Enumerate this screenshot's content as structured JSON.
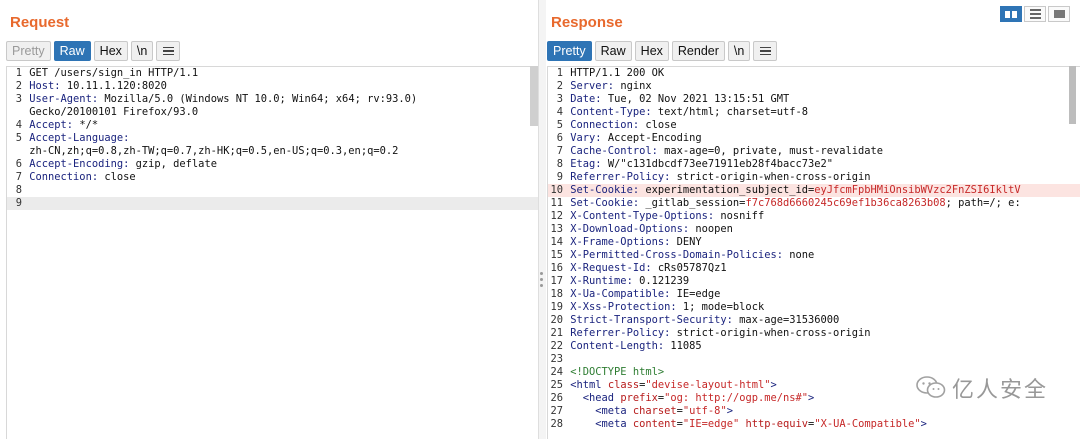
{
  "request": {
    "title": "Request",
    "tabs": [
      "Pretty",
      "Raw",
      "Hex",
      "\\n"
    ],
    "lines": [
      {
        "num": "1",
        "parts": [
          {
            "c": "code",
            "t": "GET /users/sign_in HTTP/1.1"
          }
        ]
      },
      {
        "num": "2",
        "parts": [
          {
            "c": "hk",
            "t": "Host: "
          },
          {
            "c": "hv",
            "t": "10.11.1.120:8020"
          }
        ]
      },
      {
        "num": "3",
        "parts": [
          {
            "c": "hk",
            "t": "User-Agent: "
          },
          {
            "c": "hv",
            "t": "Mozilla/5.0 (Windows NT 10.0; Win64; x64; rv:93.0)"
          }
        ]
      },
      {
        "num": "",
        "cont": true,
        "parts": [
          {
            "c": "hv",
            "t": "Gecko/20100101 Firefox/93.0"
          }
        ]
      },
      {
        "num": "4",
        "parts": [
          {
            "c": "hk",
            "t": "Accept: "
          },
          {
            "c": "hv",
            "t": "*/*"
          }
        ]
      },
      {
        "num": "5",
        "parts": [
          {
            "c": "hk",
            "t": "Accept-Language: "
          }
        ]
      },
      {
        "num": "",
        "cont": true,
        "parts": [
          {
            "c": "hv",
            "t": "zh-CN,zh;q=0.8,zh-TW;q=0.7,zh-HK;q=0.5,en-US;q=0.3,en;q=0.2"
          }
        ]
      },
      {
        "num": "6",
        "parts": [
          {
            "c": "hk",
            "t": "Accept-Encoding: "
          },
          {
            "c": "hv",
            "t": "gzip, deflate"
          }
        ]
      },
      {
        "num": "7",
        "parts": [
          {
            "c": "hk",
            "t": "Connection: "
          },
          {
            "c": "hv",
            "t": "close"
          }
        ]
      },
      {
        "num": "8",
        "parts": [
          {
            "c": "code",
            "t": ""
          }
        ]
      },
      {
        "num": "9",
        "active": true,
        "parts": [
          {
            "c": "code",
            "t": ""
          }
        ]
      }
    ]
  },
  "response": {
    "title": "Response",
    "tabs": [
      "Pretty",
      "Raw",
      "Hex",
      "Render",
      "\\n"
    ],
    "lines": [
      {
        "num": "1",
        "parts": [
          {
            "c": "code",
            "t": "HTTP/1.1 200 OK"
          }
        ]
      },
      {
        "num": "2",
        "parts": [
          {
            "c": "hk",
            "t": "Server: "
          },
          {
            "c": "hv",
            "t": "nginx"
          }
        ]
      },
      {
        "num": "3",
        "parts": [
          {
            "c": "hk",
            "t": "Date: "
          },
          {
            "c": "hv",
            "t": "Tue, 02 Nov 2021 13:15:51 GMT"
          }
        ]
      },
      {
        "num": "4",
        "parts": [
          {
            "c": "hk",
            "t": "Content-Type: "
          },
          {
            "c": "hv",
            "t": "text/html; charset=utf-8"
          }
        ]
      },
      {
        "num": "5",
        "parts": [
          {
            "c": "hk",
            "t": "Connection: "
          },
          {
            "c": "hv",
            "t": "close"
          }
        ]
      },
      {
        "num": "6",
        "parts": [
          {
            "c": "hk",
            "t": "Vary: "
          },
          {
            "c": "hv",
            "t": "Accept-Encoding"
          }
        ]
      },
      {
        "num": "7",
        "parts": [
          {
            "c": "hk",
            "t": "Cache-Control: "
          },
          {
            "c": "hv",
            "t": "max-age=0, private, must-revalidate"
          }
        ]
      },
      {
        "num": "8",
        "parts": [
          {
            "c": "hk",
            "t": "Etag: "
          },
          {
            "c": "hv",
            "t": "W/\"c131dbcdf73ee71911eb28f4bacc73e2\""
          }
        ]
      },
      {
        "num": "9",
        "parts": [
          {
            "c": "hk",
            "t": "Referrer-Policy: "
          },
          {
            "c": "hv",
            "t": "strict-origin-when-cross-origin"
          }
        ]
      },
      {
        "num": "10",
        "hl": true,
        "parts": [
          {
            "c": "hk",
            "t": "Set-Cookie: "
          },
          {
            "c": "ck",
            "t": "experimentation_subject_id="
          },
          {
            "c": "cv",
            "t": "eyJfcmFpbHMiOnsibWVzc2FnZSI6IkltV"
          }
        ]
      },
      {
        "num": "11",
        "parts": [
          {
            "c": "hk",
            "t": "Set-Cookie: "
          },
          {
            "c": "ck",
            "t": "_gitlab_session="
          },
          {
            "c": "cv",
            "t": "f7c768d6660245c69ef1b36ca8263b08"
          },
          {
            "c": "hv",
            "t": "; path=/; e:"
          }
        ]
      },
      {
        "num": "12",
        "parts": [
          {
            "c": "hk",
            "t": "X-Content-Type-Options: "
          },
          {
            "c": "hv",
            "t": "nosniff"
          }
        ]
      },
      {
        "num": "13",
        "parts": [
          {
            "c": "hk",
            "t": "X-Download-Options: "
          },
          {
            "c": "hv",
            "t": "noopen"
          }
        ]
      },
      {
        "num": "14",
        "parts": [
          {
            "c": "hk",
            "t": "X-Frame-Options: "
          },
          {
            "c": "hv",
            "t": "DENY"
          }
        ]
      },
      {
        "num": "15",
        "parts": [
          {
            "c": "hk",
            "t": "X-Permitted-Cross-Domain-Policies: "
          },
          {
            "c": "hv",
            "t": "none"
          }
        ]
      },
      {
        "num": "16",
        "parts": [
          {
            "c": "hk",
            "t": "X-Request-Id: "
          },
          {
            "c": "hv",
            "t": "cRs05787Qz1"
          }
        ]
      },
      {
        "num": "17",
        "parts": [
          {
            "c": "hk",
            "t": "X-Runtime: "
          },
          {
            "c": "hv",
            "t": "0.121239"
          }
        ]
      },
      {
        "num": "18",
        "parts": [
          {
            "c": "hk",
            "t": "X-Ua-Compatible: "
          },
          {
            "c": "hv",
            "t": "IE=edge"
          }
        ]
      },
      {
        "num": "19",
        "parts": [
          {
            "c": "hk",
            "t": "X-Xss-Protection: "
          },
          {
            "c": "hv",
            "t": "1; mode=block"
          }
        ]
      },
      {
        "num": "20",
        "parts": [
          {
            "c": "hk",
            "t": "Strict-Transport-Security: "
          },
          {
            "c": "hv",
            "t": "max-age=31536000"
          }
        ]
      },
      {
        "num": "21",
        "parts": [
          {
            "c": "hk",
            "t": "Referrer-Policy: "
          },
          {
            "c": "hv",
            "t": "strict-origin-when-cross-origin"
          }
        ]
      },
      {
        "num": "22",
        "parts": [
          {
            "c": "hk",
            "t": "Content-Length: "
          },
          {
            "c": "hv",
            "t": "11085"
          }
        ]
      },
      {
        "num": "23",
        "parts": [
          {
            "c": "code",
            "t": ""
          }
        ]
      },
      {
        "num": "24",
        "parts": [
          {
            "c": "comment",
            "t": "<!DOCTYPE html>"
          }
        ]
      },
      {
        "num": "25",
        "parts": [
          {
            "c": "tag",
            "t": "<html "
          },
          {
            "c": "attr",
            "t": "class"
          },
          {
            "c": "punct",
            "t": "="
          },
          {
            "c": "val",
            "t": "\"devise-layout-html\""
          },
          {
            "c": "tag",
            "t": ">"
          }
        ]
      },
      {
        "num": "26",
        "parts": [
          {
            "c": "code",
            "t": "  "
          },
          {
            "c": "tag",
            "t": "<head "
          },
          {
            "c": "attr",
            "t": "prefix"
          },
          {
            "c": "punct",
            "t": "="
          },
          {
            "c": "val",
            "t": "\"og: http://ogp.me/ns#\""
          },
          {
            "c": "tag",
            "t": ">"
          }
        ]
      },
      {
        "num": "27",
        "parts": [
          {
            "c": "code",
            "t": "    "
          },
          {
            "c": "tag",
            "t": "<meta "
          },
          {
            "c": "attr",
            "t": "charset"
          },
          {
            "c": "punct",
            "t": "="
          },
          {
            "c": "val",
            "t": "\"utf-8\""
          },
          {
            "c": "tag",
            "t": ">"
          }
        ]
      },
      {
        "num": "28",
        "parts": [
          {
            "c": "code",
            "t": "    "
          },
          {
            "c": "tag",
            "t": "<meta "
          },
          {
            "c": "attr",
            "t": "content"
          },
          {
            "c": "punct",
            "t": "="
          },
          {
            "c": "val",
            "t": "\"IE=edge\""
          },
          {
            "c": "code",
            "t": " "
          },
          {
            "c": "attr",
            "t": "http-equiv"
          },
          {
            "c": "punct",
            "t": "="
          },
          {
            "c": "val",
            "t": "\"X-UA-Compatible\""
          },
          {
            "c": "tag",
            "t": ">"
          }
        ]
      }
    ]
  },
  "watermark": {
    "text": "亿人安全",
    "icon": "wechat-icon"
  },
  "colors": {
    "accent": "#2e74b5",
    "title": "#e8692d"
  }
}
